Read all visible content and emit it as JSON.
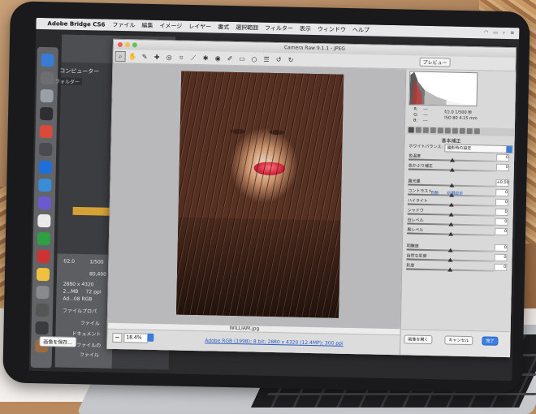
{
  "menubar": {
    "app_name": "Adobe Bridge CS6",
    "items": [
      "ファイル",
      "編集",
      "イメージ",
      "レイヤー",
      "書式",
      "選択範囲",
      "フィルター",
      "表示",
      "ウィンドウ",
      "ヘルプ"
    ]
  },
  "bridge": {
    "tab_computer": "コンピューター",
    "tab_folder": "フォルダー",
    "meta": {
      "aperture": "f/2.0",
      "value1": "1/500",
      "iso": "80,400",
      "dimensions": "2880 x 4320",
      "size": "2...MB",
      "ppi": "72 ppi",
      "mode": "Ad...08 RGB",
      "file_props": "ファイルプロパ",
      "file_label": "ファイル",
      "doc_label": "ドキュメント",
      "file_label2": "ファイルの",
      "file_label3": "ファイル"
    }
  },
  "camera_raw": {
    "title": "Camera Raw 9.1.1 - JPEG",
    "preview_button": "プレビュー",
    "zoom_value": "18.4%",
    "filename": "WILLIAM.jpg",
    "info_link": "Adobe RGB (1998); 8 bit; 2880 x 4320 (12.4MP); 300 ppi",
    "save_button": "画像を保存...",
    "open_button": "画像を開く",
    "cancel_button": "キャンセル",
    "done_button": "完了",
    "panel": {
      "section_title": "基本補正",
      "wb_label": "ホワイトバランス:",
      "wb_value": "撮影時の設定",
      "auto_link": "自動",
      "default_link": "初期設定",
      "rgb_labels": [
        "R:",
        "G:",
        "B:"
      ],
      "rgb_values": [
        "---",
        "---",
        "---"
      ],
      "exif": [
        "f/2.0  1/500 秒",
        "ISO 80  4.15 mm"
      ],
      "sliders": [
        {
          "label": "色温度",
          "value": "0",
          "pos": 0.5
        },
        {
          "label": "色かぶり補正",
          "value": "0",
          "pos": 0.5
        },
        {
          "label": "露光量",
          "value": "+0.00",
          "pos": 0.5
        },
        {
          "label": "コントラスト",
          "value": "0",
          "pos": 0.5
        },
        {
          "label": "ハイライト",
          "value": "0",
          "pos": 0.5
        },
        {
          "label": "シャドウ",
          "value": "0",
          "pos": 0.5
        },
        {
          "label": "白レベル",
          "value": "0",
          "pos": 0.5
        },
        {
          "label": "黒レベル",
          "value": "0",
          "pos": 0.5
        },
        {
          "label": "明瞭度",
          "value": "0",
          "pos": 0.5
        },
        {
          "label": "自然な彩度",
          "value": "0",
          "pos": 0.5
        },
        {
          "label": "彩度",
          "value": "0",
          "pos": 0.5
        }
      ]
    }
  },
  "colors": {
    "accent": "#3c7ddc",
    "bridge_yellow": "#d6a236"
  }
}
